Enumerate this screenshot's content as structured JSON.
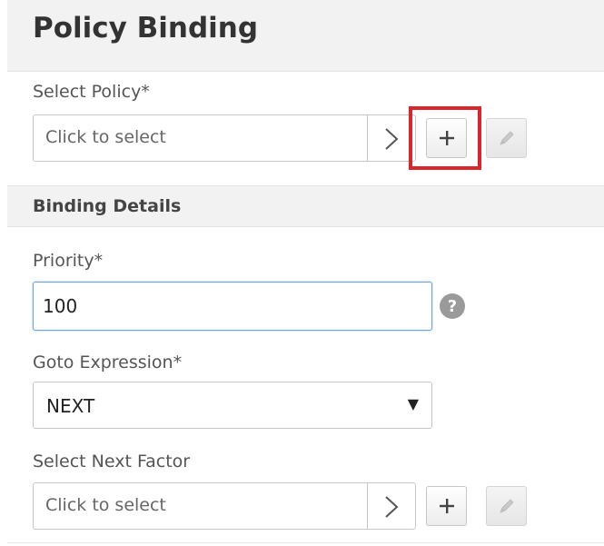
{
  "header": {
    "title": "Policy Binding"
  },
  "select_policy": {
    "label": "Select Policy*",
    "placeholder": "Click to select",
    "add_icon": "plus-icon",
    "edit_icon": "pencil-icon"
  },
  "binding_details": {
    "title": "Binding Details"
  },
  "priority": {
    "label": "Priority*",
    "value": "100",
    "help_icon": "question-icon"
  },
  "goto_expression": {
    "label": "Goto Expression*",
    "value": "NEXT"
  },
  "select_next_factor": {
    "label": "Select Next Factor",
    "placeholder": "Click to select",
    "add_icon": "plus-icon",
    "edit_icon": "pencil-icon"
  },
  "colors": {
    "highlight": "#d9262c",
    "focus_border": "#6aa7d8"
  }
}
